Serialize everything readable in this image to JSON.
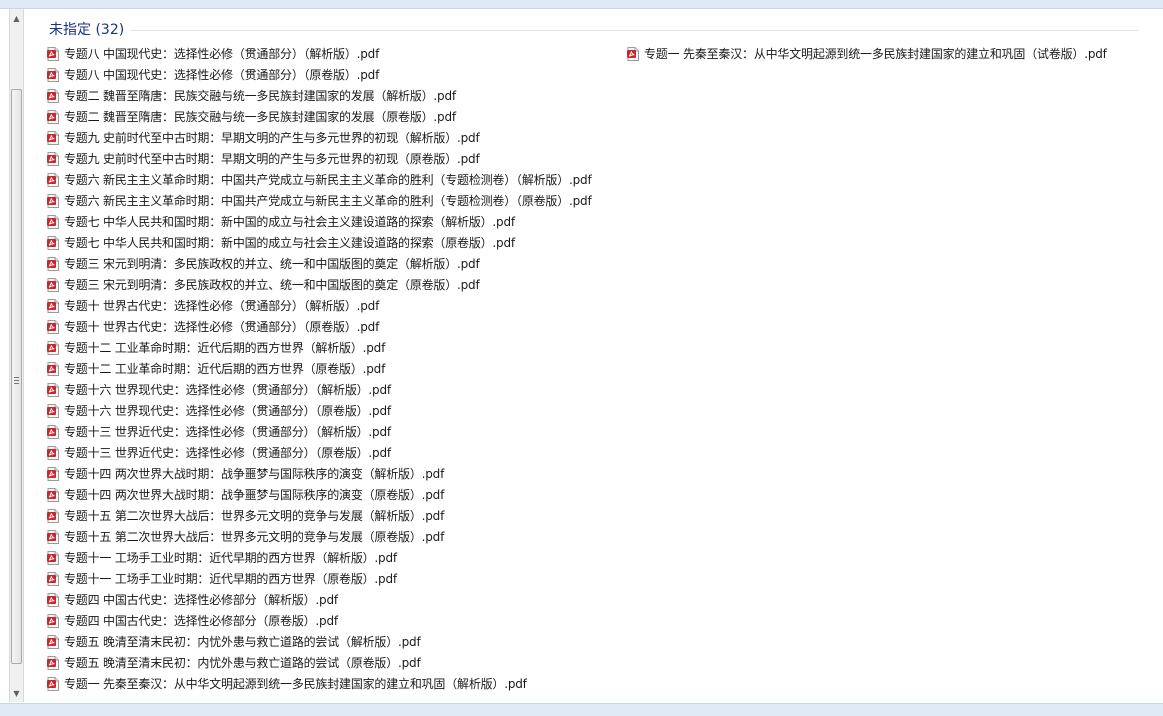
{
  "group": {
    "title": "未指定 (32)"
  },
  "files_left": [
    "专题八 中国现代史：选择性必修（贯通部分）（解析版）.pdf",
    "专题八 中国现代史：选择性必修（贯通部分）（原卷版）.pdf",
    "专题二 魏晋至隋唐：民族交融与统一多民族封建国家的发展（解析版）.pdf",
    "专题二 魏晋至隋唐：民族交融与统一多民族封建国家的发展（原卷版）.pdf",
    "专题九 史前时代至中古时期：早期文明的产生与多元世界的初现（解析版）.pdf",
    "专题九 史前时代至中古时期：早期文明的产生与多元世界的初现（原卷版）.pdf",
    "专题六 新民主主义革命时期：中国共产党成立与新民主主义革命的胜利（专题检测卷）（解析版）.pdf",
    "专题六 新民主主义革命时期：中国共产党成立与新民主主义革命的胜利（专题检测卷）（原卷版）.pdf",
    "专题七 中华人民共和国时期：新中国的成立与社会主义建设道路的探索（解析版）.pdf",
    "专题七 中华人民共和国时期：新中国的成立与社会主义建设道路的探索（原卷版）.pdf",
    "专题三 宋元到明清：多民族政权的并立、统一和中国版图的奠定（解析版）.pdf",
    "专题三 宋元到明清：多民族政权的并立、统一和中国版图的奠定（原卷版）.pdf",
    "专题十 世界古代史：选择性必修（贯通部分）（解析版）.pdf",
    "专题十 世界古代史：选择性必修（贯通部分）（原卷版）.pdf",
    "专题十二 工业革命时期：近代后期的西方世界（解析版）.pdf",
    "专题十二 工业革命时期：近代后期的西方世界（原卷版）.pdf",
    "专题十六 世界现代史：选择性必修（贯通部分）（解析版）.pdf",
    "专题十六 世界现代史：选择性必修（贯通部分）（原卷版）.pdf",
    "专题十三 世界近代史：选择性必修（贯通部分）（解析版）.pdf",
    "专题十三 世界近代史：选择性必修（贯通部分）（原卷版）.pdf",
    "专题十四 两次世界大战时期：战争噩梦与国际秩序的演变（解析版）.pdf",
    "专题十四 两次世界大战时期：战争噩梦与国际秩序的演变（原卷版）.pdf",
    "专题十五 第二次世界大战后：世界多元文明的竞争与发展（解析版）.pdf",
    "专题十五 第二次世界大战后：世界多元文明的竞争与发展（原卷版）.pdf",
    "专题十一 工场手工业时期：近代早期的西方世界（解析版）.pdf",
    "专题十一 工场手工业时期：近代早期的西方世界（原卷版）.pdf",
    "专题四 中国古代史：选择性必修部分（解析版）.pdf",
    "专题四 中国古代史：选择性必修部分（原卷版）.pdf",
    "专题五  晚清至清末民初：内忧外患与救亡道路的尝试（解析版）.pdf",
    "专题五  晚清至清末民初：内忧外患与救亡道路的尝试（原卷版）.pdf",
    "专题一 先秦至秦汉：从中华文明起源到统一多民族封建国家的建立和巩固（解析版）.pdf"
  ],
  "files_right": [
    "专题一 先秦至秦汉：从中华文明起源到统一多民族封建国家的建立和巩固（试卷版）.pdf"
  ],
  "icons": {
    "file": "pdf-file-icon",
    "scroll_up": "scroll-up-arrow-icon",
    "scroll_down": "scroll-down-arrow-icon"
  },
  "colors": {
    "group_title": "#1e3287",
    "pdf_red": "#c8282d"
  }
}
